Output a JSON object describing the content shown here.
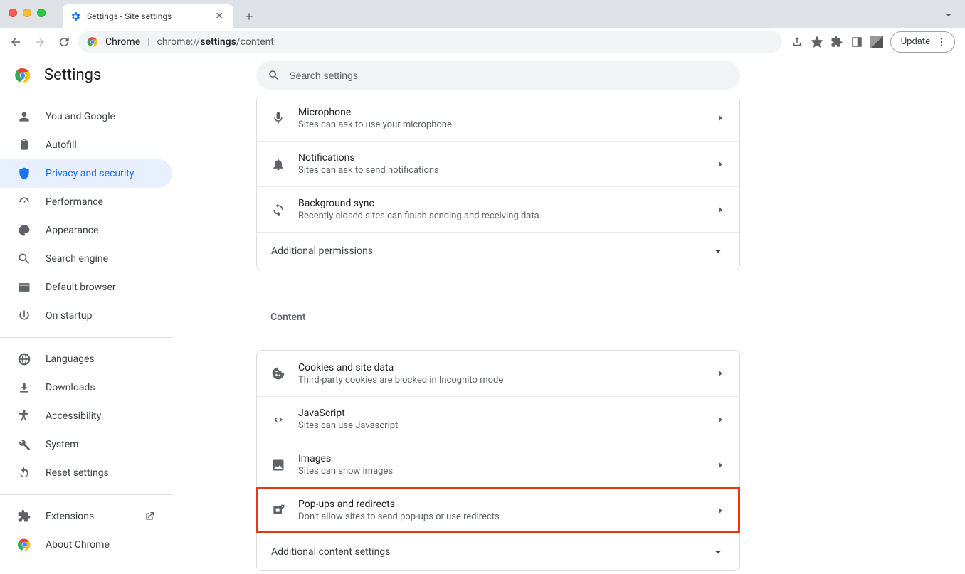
{
  "window": {
    "tab_title": "Settings - Site settings",
    "omnibox_label": "Chrome",
    "omnibox_url_proto": "chrome://",
    "omnibox_url_bold": "settings",
    "omnibox_url_rest": "/content",
    "update_label": "Update"
  },
  "header": {
    "title": "Settings",
    "search_placeholder": "Search settings"
  },
  "sidebar": {
    "items": [
      {
        "label": "You and Google",
        "icon": "person"
      },
      {
        "label": "Autofill",
        "icon": "clipboard"
      },
      {
        "label": "Privacy and security",
        "icon": "shield",
        "active": true
      },
      {
        "label": "Performance",
        "icon": "speed"
      },
      {
        "label": "Appearance",
        "icon": "palette"
      },
      {
        "label": "Search engine",
        "icon": "search"
      },
      {
        "label": "Default browser",
        "icon": "browser"
      },
      {
        "label": "On startup",
        "icon": "power"
      }
    ],
    "items2": [
      {
        "label": "Languages",
        "icon": "globe"
      },
      {
        "label": "Downloads",
        "icon": "download"
      },
      {
        "label": "Accessibility",
        "icon": "accessibility"
      },
      {
        "label": "System",
        "icon": "wrench"
      },
      {
        "label": "Reset settings",
        "icon": "restore"
      }
    ],
    "items3": [
      {
        "label": "Extensions",
        "icon": "extension",
        "external": true
      },
      {
        "label": "About Chrome",
        "icon": "chrome"
      }
    ]
  },
  "permissions": {
    "rows": [
      {
        "title": "Microphone",
        "sub": "Sites can ask to use your microphone",
        "icon": "mic"
      },
      {
        "title": "Notifications",
        "sub": "Sites can ask to send notifications",
        "icon": "bell"
      },
      {
        "title": "Background sync",
        "sub": "Recently closed sites can finish sending and receiving data",
        "icon": "sync"
      }
    ],
    "expand": "Additional permissions"
  },
  "content": {
    "title": "Content",
    "rows": [
      {
        "title": "Cookies and site data",
        "sub": "Third-party cookies are blocked in Incognito mode",
        "icon": "cookie"
      },
      {
        "title": "JavaScript",
        "sub": "Sites can use Javascript",
        "icon": "code"
      },
      {
        "title": "Images",
        "sub": "Sites can show images",
        "icon": "image"
      },
      {
        "title": "Pop-ups and redirects",
        "sub": "Don't allow sites to send pop-ups or use redirects",
        "icon": "popup",
        "highlight": true
      }
    ],
    "expand": "Additional content settings"
  }
}
